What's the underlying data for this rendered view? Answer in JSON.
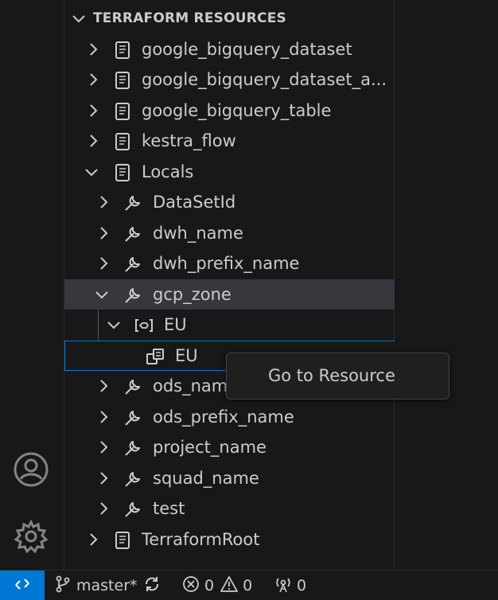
{
  "section": {
    "title": "TERRAFORM RESOURCES"
  },
  "tree": {
    "google_bigquery_dataset": "google_bigquery_dataset",
    "google_bigquery_dataset_a": "google_bigquery_dataset_a...",
    "google_bigquery_table": "google_bigquery_table",
    "kestra_flow": "kestra_flow",
    "locals": "Locals",
    "DataSetId": "DataSetId",
    "dwh_name": "dwh_name",
    "dwh_prefix_name": "dwh_prefix_name",
    "gcp_zone": "gcp_zone",
    "eu_map": "EU",
    "eu_value": "EU",
    "ods_name": "ods_name",
    "ods_prefix_name": "ods_prefix_name",
    "project_name": "project_name",
    "squad_name": "squad_name",
    "test": "test",
    "terraform_root": "TerraformRoot"
  },
  "context_menu": {
    "go_to_resource": "Go to Resource"
  },
  "status_bar": {
    "branch": "master*",
    "errors": "0",
    "warnings": "0",
    "ports": "0"
  },
  "icons": {
    "resource": "file-code-icon",
    "local": "wrench-icon",
    "map": "symbol-namespace-icon",
    "value": "symbol-value-icon",
    "accounts": "account-icon",
    "settings": "gear-icon",
    "remote": "remote-icon",
    "branch": "source-control-icon",
    "sync": "sync-icon",
    "error": "error-icon",
    "warning": "warning-icon",
    "ports": "broadcast-icon"
  },
  "colors": {
    "accent": "#0078d4",
    "selection": "#37373d",
    "background": "#181818"
  }
}
